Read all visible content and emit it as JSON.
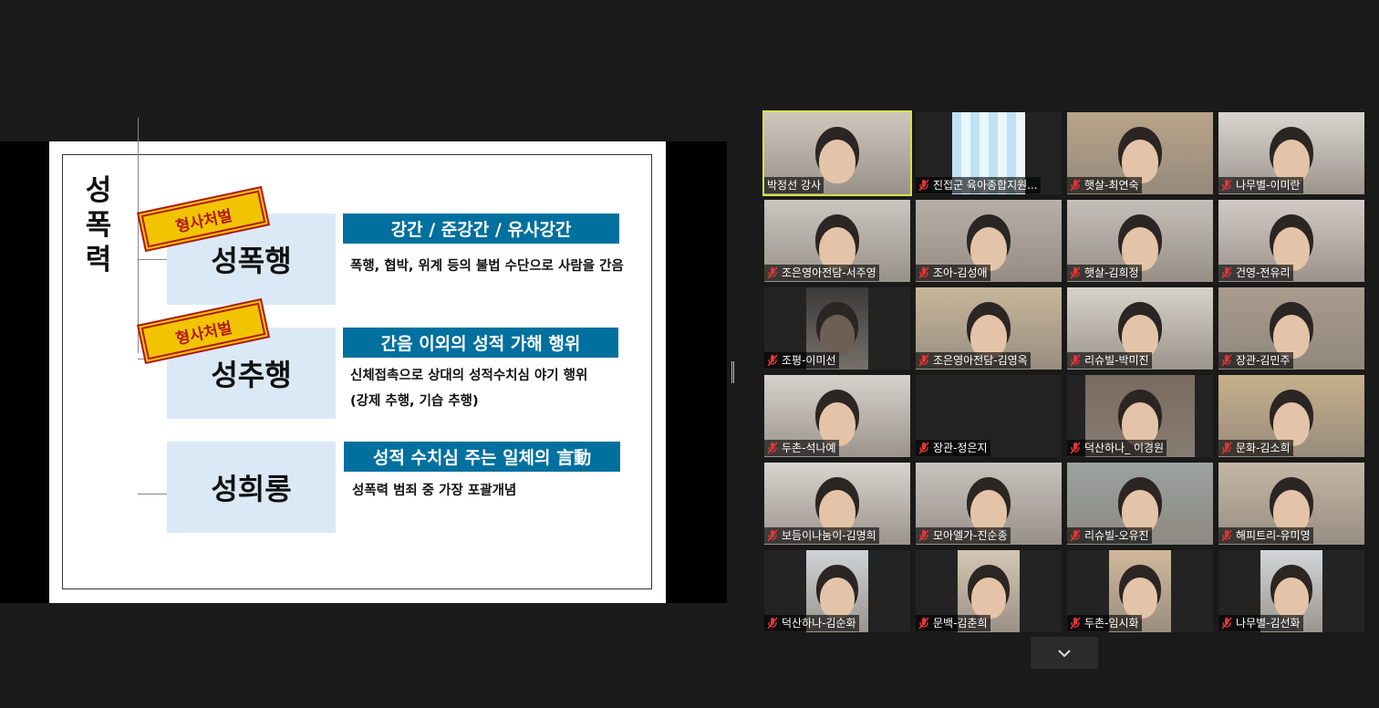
{
  "slide": {
    "vertical_title": "성\n폭\n력",
    "stamp_label": "형사처벌",
    "categories": [
      {
        "name": "성폭행",
        "heading": "강간 / 준강간 / 유사강간",
        "desc": "폭행, 협박, 위계 등의 불법 수단으로 사람을 간음"
      },
      {
        "name": "성추행",
        "heading": "간음 이외의 성적 가해 행위",
        "desc": "신체접촉으로 상대의 성적수치심 야기 행위\n(강제 추행, 기습 추행)"
      },
      {
        "name": "성희롱",
        "heading": "성적 수치심 주는 일체의 言動",
        "desc": "성폭력 범죄 중 가장 포괄개념"
      }
    ]
  },
  "participants": [
    {
      "name": "박정선 강사",
      "muted": false,
      "active": true
    },
    {
      "name": "진접군 육아종합지원...",
      "muted": true
    },
    {
      "name": "햇살-최연숙",
      "muted": true
    },
    {
      "name": "나무별-이미란",
      "muted": true
    },
    {
      "name": "조은영아전담-서주영",
      "muted": true
    },
    {
      "name": "조아-김성애",
      "muted": true
    },
    {
      "name": "햇살-김희정",
      "muted": true
    },
    {
      "name": "건영-전유리",
      "muted": true
    },
    {
      "name": "조평-이미선",
      "muted": true
    },
    {
      "name": "조은영아전담-김영옥",
      "muted": true
    },
    {
      "name": "리슈빌-박미진",
      "muted": true
    },
    {
      "name": "장관-김민주",
      "muted": true
    },
    {
      "name": "두촌-석나예",
      "muted": true
    },
    {
      "name": "장관-정은지",
      "muted": true
    },
    {
      "name": "덕산하나_ 이경원",
      "muted": true
    },
    {
      "name": "문화-김소희",
      "muted": true
    },
    {
      "name": "보듬이나눔이-김명희",
      "muted": true
    },
    {
      "name": "모아엘가-진순종",
      "muted": true
    },
    {
      "name": "리슈빌-오유진",
      "muted": true
    },
    {
      "name": "해피트리-유미영",
      "muted": true
    },
    {
      "name": "덕산하나-김순화",
      "muted": true
    },
    {
      "name": "문백-김춘희",
      "muted": true
    },
    {
      "name": "두촌-임시화",
      "muted": true
    },
    {
      "name": "나무별-김선화",
      "muted": true
    }
  ],
  "colors": {
    "accent_bar": "#00709e",
    "active_border": "#d5e24a",
    "muted_mic": "#e0343a"
  },
  "icons": {
    "mic_off": "mic-off-icon",
    "scroll_down": "chevron-down-icon"
  }
}
